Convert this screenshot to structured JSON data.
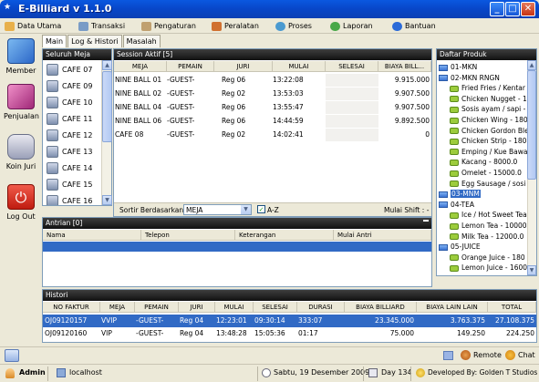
{
  "window": {
    "title": "E-Billiard v 1.1.0"
  },
  "menu": [
    {
      "label": "Data Utama",
      "icon": "data-utama-icon",
      "color": "#e8b04a"
    },
    {
      "label": "Transaksi",
      "icon": "transaksi-icon",
      "color": "#7a9cc6"
    },
    {
      "label": "Pengaturan",
      "icon": "pengaturan-icon",
      "color": "#c0a070"
    },
    {
      "label": "Peralatan",
      "icon": "peralatan-icon",
      "color": "#d07030"
    },
    {
      "label": "Proses",
      "icon": "proses-icon",
      "color": "#4a9ad0"
    },
    {
      "label": "Laporan",
      "icon": "laporan-icon",
      "color": "#48a848"
    },
    {
      "label": "Bantuan",
      "icon": "bantuan-icon",
      "color": "#2a6ad8"
    }
  ],
  "sidebar": [
    {
      "label": "Member",
      "icon": "member-card-icon"
    },
    {
      "label": "Penjualan",
      "icon": "penjualan-icon"
    },
    {
      "label": "Koin Juri",
      "icon": "koin-juri-icon"
    },
    {
      "label": "Log Out",
      "icon": "power-icon"
    }
  ],
  "tabs": [
    "Main",
    "Log & Histori",
    "Masalah"
  ],
  "meja": {
    "header": "Seluruh Meja",
    "items": [
      "CAFE 07",
      "CAFE 09",
      "CAFE 10",
      "CAFE 11",
      "CAFE 12",
      "CAFE 13",
      "CAFE 14",
      "CAFE 15",
      "CAFE 16"
    ]
  },
  "session": {
    "header": "Session Aktif [5]",
    "columns": [
      "MEJA",
      "PEMAIN",
      "JURI",
      "MULAI",
      "SELESAI",
      "BIAYA BILL..."
    ],
    "rows": [
      [
        "NINE BALL 01",
        "-GUEST-",
        "Reg 06",
        "13:22:08",
        "",
        "9.915.000"
      ],
      [
        "NINE BALL 02",
        "-GUEST-",
        "Reg 02",
        "13:53:03",
        "",
        "9.907.500"
      ],
      [
        "NINE BALL 04",
        "-GUEST-",
        "Reg 06",
        "13:55:47",
        "",
        "9.907.500"
      ],
      [
        "NINE BALL 06",
        "-GUEST-",
        "Reg 06",
        "14:44:59",
        "",
        "9.892.500"
      ],
      [
        "CAFE 08",
        "-GUEST-",
        "Reg 02",
        "14:02:41",
        "",
        "0"
      ]
    ],
    "sort_label": "Sortir Berdasarkan :",
    "sort_value": "MEJA",
    "az_label": "A-Z",
    "shift_label": "Mulai Shift : -"
  },
  "produk": {
    "header": "Daftar Produk",
    "items": [
      {
        "label": "01-MKN",
        "type": "folder",
        "level": 0
      },
      {
        "label": "02-MKN RNGN",
        "type": "folder",
        "level": 0
      },
      {
        "label": "Fried Fries / Kentar",
        "type": "leaf",
        "level": 1
      },
      {
        "label": "Chicken Nugget - 1",
        "type": "leaf",
        "level": 1
      },
      {
        "label": "Sosis ayam / sapi -",
        "type": "leaf",
        "level": 1
      },
      {
        "label": "Chicken Wing - 180",
        "type": "leaf",
        "level": 1
      },
      {
        "label": "Chicken Gordon Ble",
        "type": "leaf",
        "level": 1
      },
      {
        "label": "Chicken Strip - 180",
        "type": "leaf",
        "level": 1
      },
      {
        "label": "Emping / Kue Bawa",
        "type": "leaf",
        "level": 1
      },
      {
        "label": "Kacang - 8000.0",
        "type": "leaf",
        "level": 1
      },
      {
        "label": "Omelet - 15000.0",
        "type": "leaf",
        "level": 1
      },
      {
        "label": "Egg Sausage / sosi",
        "type": "leaf",
        "level": 1
      },
      {
        "label": "03-MNM",
        "type": "folder",
        "level": 0,
        "selected": true
      },
      {
        "label": "04-TEA",
        "type": "folder",
        "level": 0
      },
      {
        "label": "Ice / Hot Sweet Tea",
        "type": "leaf",
        "level": 1
      },
      {
        "label": "Lemon Tea - 10000",
        "type": "leaf",
        "level": 1
      },
      {
        "label": "Milk Tea - 12000.0",
        "type": "leaf",
        "level": 1
      },
      {
        "label": "05-JUICE",
        "type": "folder",
        "level": 0
      },
      {
        "label": "Orange Juice - 180",
        "type": "leaf",
        "level": 1
      },
      {
        "label": "Lemon Juice - 1600",
        "type": "leaf",
        "level": 1
      }
    ]
  },
  "antrian": {
    "header": "Antrian [0]",
    "columns": [
      "Nama",
      "Telepon",
      "Keterangan",
      "Mulai Antri"
    ]
  },
  "histori": {
    "header": "Histori",
    "columns": [
      "NO FAKTUR",
      "MEJA",
      "PEMAIN",
      "JURI",
      "MULAI",
      "SELESAI",
      "DURASI",
      "BIAYA BILLIARD",
      "BIAYA LAIN LAIN",
      "TOTAL"
    ],
    "rows": [
      [
        "OJ09120157",
        "VVIP",
        "-GUEST-",
        "Reg 04",
        "12:23:01",
        "09:30:14",
        "333:07",
        "23.345.000",
        "3.763.375",
        "27.108.375"
      ],
      [
        "OJ09120160",
        "VIP",
        "-GUEST-",
        "Reg 04",
        "13:48:28",
        "15:05:36",
        "01:17",
        "75.000",
        "149.250",
        "224.250"
      ]
    ]
  },
  "status": {
    "user": "Admin",
    "host": "localhost",
    "date": "Sabtu, 19 Desember 2009",
    "day": "Day 134",
    "developer": "Developed By: Golden T Studios",
    "remote": "Remote",
    "chat": "Chat"
  },
  "colors": {
    "titlebar": "#0846c8",
    "selection": "#316ac5",
    "panel_header": "#1a1a1a"
  }
}
